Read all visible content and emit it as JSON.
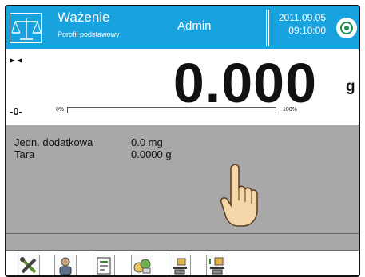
{
  "header": {
    "title": "Ważenie",
    "subtitle": "Porofil podstawowy",
    "user": "Admin",
    "date": "2011.09.05",
    "time": "09:10:00",
    "mode_icon": "balance-scale-icon",
    "action_icon": "target-circle-icon"
  },
  "display": {
    "reading": "0.000",
    "unit": "g",
    "zero_indicator": "-0-",
    "stability_icon": "stability-marker-icon",
    "bar_min_label": "0%",
    "bar_max_label": "100%",
    "bar_fill_fraction": 0
  },
  "info": [
    {
      "label": "Jedn. dodatkowa",
      "value": "0.0 mg"
    },
    {
      "label": "Tara",
      "value": "0.0000 g"
    }
  ],
  "panel_icon": "pointing-hand-icon",
  "toolbar": [
    {
      "icon": "tools-icon"
    },
    {
      "icon": "user-icon"
    },
    {
      "icon": "document-icon"
    },
    {
      "icon": "products-icon"
    },
    {
      "icon": "tare-icon"
    },
    {
      "icon": "tare-load-icon"
    }
  ],
  "colors": {
    "header_bg": "#19a3de",
    "panel_bg": "#a8a8a8",
    "ok_green": "#1d8f55"
  }
}
